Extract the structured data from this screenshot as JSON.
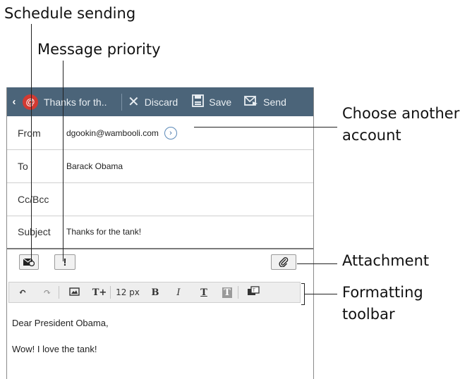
{
  "callouts": {
    "schedule_sending": "Schedule sending",
    "message_priority": "Message priority",
    "choose_account_l1": "Choose another",
    "choose_account_l2": "account",
    "attachment": "Attachment",
    "formatting_l1": "Formatting",
    "formatting_l2": "toolbar"
  },
  "actionbar": {
    "back_icon": "chevron-left",
    "title": "Thanks for th..",
    "discard": "Discard",
    "save": "Save",
    "send": "Send"
  },
  "fields": {
    "from_label": "From",
    "from_value": "dgookin@wambooli.com",
    "to_label": "To",
    "to_value": "Barack Obama",
    "ccbcc_label": "Cc/Bcc",
    "ccbcc_value": "",
    "subject_label": "Subject",
    "subject_value": "Thanks for the tank!"
  },
  "options": {
    "schedule_icon": "envelope-clock",
    "priority_icon": "!",
    "attach_icon": "paperclip"
  },
  "toolbar": {
    "undo": "↶",
    "redo": "↷",
    "insert_image": "image",
    "text_size_icon": "T+",
    "font_size": "12 px",
    "bold": "B",
    "italic": "I",
    "underline": "T",
    "highlight": "T",
    "more": "more"
  },
  "message": {
    "line1": "Dear President Obama,",
    "line2": "Wow! I love the tank!"
  }
}
